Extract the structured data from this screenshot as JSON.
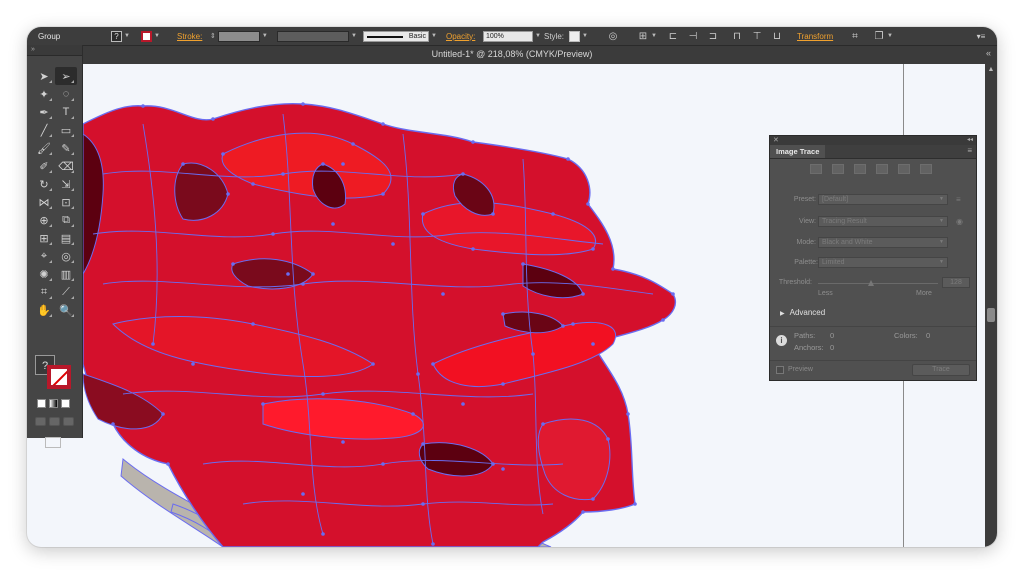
{
  "control_bar": {
    "selection_type": "Group",
    "fill_icon": "question-mark-swatch",
    "stroke_label": "Stroke:",
    "brush_label": "Basic",
    "opacity_label": "Opacity:",
    "opacity_value": "100%",
    "style_label": "Style:",
    "transform_label": "Transform"
  },
  "document": {
    "title": "Untitled-1* @ 218,08% (CMYK/Preview)"
  },
  "toolbox": {
    "fill_symbol": "?"
  },
  "image_trace": {
    "panel_title": "Image Trace",
    "preset_label": "Preset:",
    "preset_value": "[Default]",
    "view_label": "View:",
    "view_value": "Tracing Result",
    "mode_label": "Mode:",
    "mode_value": "Black and White",
    "palette_label": "Palette:",
    "palette_value": "Limited",
    "threshold_label": "Threshold:",
    "threshold_value": "128",
    "less_label": "Less",
    "more_label": "More",
    "advanced_label": "Advanced",
    "paths_label": "Paths:",
    "paths_value": "0",
    "colors_label": "Colors:",
    "colors_value": "0",
    "anchors_label": "Anchors:",
    "anchors_value": "0",
    "preview_label": "Preview",
    "trace_button": "Trace"
  },
  "colors": {
    "accent_orange": "#f0a12e",
    "rose_red": "#d4102c",
    "rose_dark": "#5c0010",
    "anchor_blue": "#6a6cf0"
  }
}
